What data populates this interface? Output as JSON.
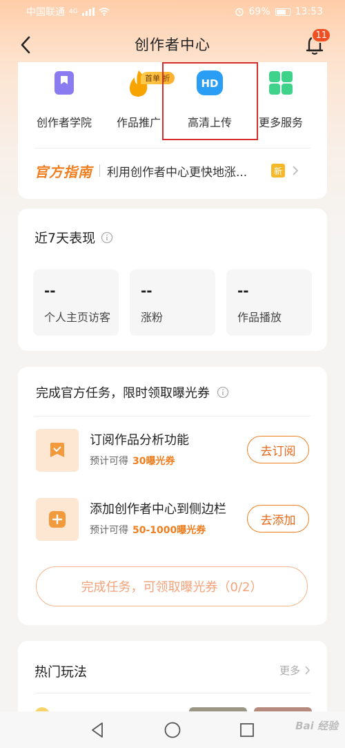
{
  "status_bar": {
    "carrier": "中国联通",
    "net": "4G",
    "battery": "69%",
    "time": "13:53"
  },
  "header": {
    "title": "创作者中心",
    "notification_count": "11"
  },
  "services": {
    "items": [
      {
        "label": "创作者学院",
        "icon": "book-bookmark-icon",
        "color": "#8a7cf0"
      },
      {
        "label": "作品推广",
        "icon": "flame-icon",
        "color": "#f5a100"
      },
      {
        "label": "高清上传",
        "icon": "hd-icon",
        "color": "#2a9df4"
      },
      {
        "label": "更多服务",
        "icon": "grid-icon",
        "color": "#3ed28a"
      }
    ],
    "promo_badge": "首单 折",
    "guide_logo": "官方指南",
    "guide_text": "利用创作者中心更快地涨...",
    "guide_new": "新"
  },
  "performance": {
    "title": "近7天表现",
    "stats": [
      {
        "value": "--",
        "label": "个人主页访客"
      },
      {
        "value": "--",
        "label": "涨粉"
      },
      {
        "value": "--",
        "label": "作品播放"
      }
    ]
  },
  "tasks": {
    "title": "完成官方任务，限时领取曝光券",
    "items": [
      {
        "name": "订阅作品分析功能",
        "sub_prefix": "预计可得",
        "reward": "30曝光券",
        "button": "去订阅",
        "icon": "bookmark-check-icon"
      },
      {
        "name": "添加创作者中心到侧边栏",
        "sub_prefix": "预计可得",
        "reward": "50-1000曝光券",
        "button": "去添加",
        "icon": "plus-icon"
      }
    ],
    "complete_button": "完成任务，可领取曝光券（0/2）"
  },
  "hot": {
    "title": "热门玩法",
    "more": "更多"
  },
  "watermark": "Bai 经验"
}
